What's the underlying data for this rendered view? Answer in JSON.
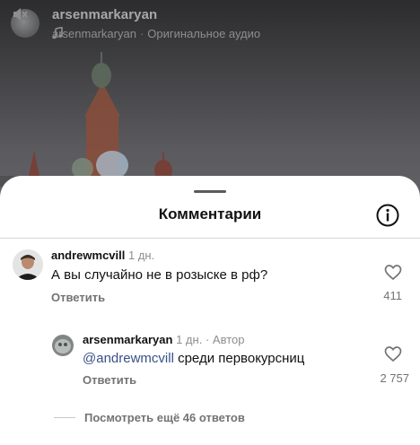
{
  "reel": {
    "username": "arsenmarkaryan",
    "audio_artist": "arsenmarkaryan",
    "audio_separator": "·",
    "audio_label": "Оригинальное аудио"
  },
  "comments_sheet": {
    "title": "Комментарии",
    "comments": [
      {
        "username": "andrewmcvill",
        "time": "1 дн.",
        "text": "А вы случайно не в розыске в рф?",
        "reply_label": "Ответить",
        "likes": "411"
      },
      {
        "username": "arsenmarkaryan",
        "time": "1 дн.",
        "separator": "·",
        "author_badge": "Автор",
        "mention": "@andrewmcvill",
        "text": " среди первокурсниц",
        "reply_label": "Ответить",
        "likes": "2 757"
      }
    ],
    "view_more_label": "Посмотреть ещё 46 ответов"
  },
  "colors": {
    "mention": "#385185",
    "secondary_text": "#737373",
    "sheet_background": "#ffffff"
  },
  "icons": [
    "music-note-icon",
    "mute-icon",
    "info-icon",
    "heart-icon"
  ]
}
